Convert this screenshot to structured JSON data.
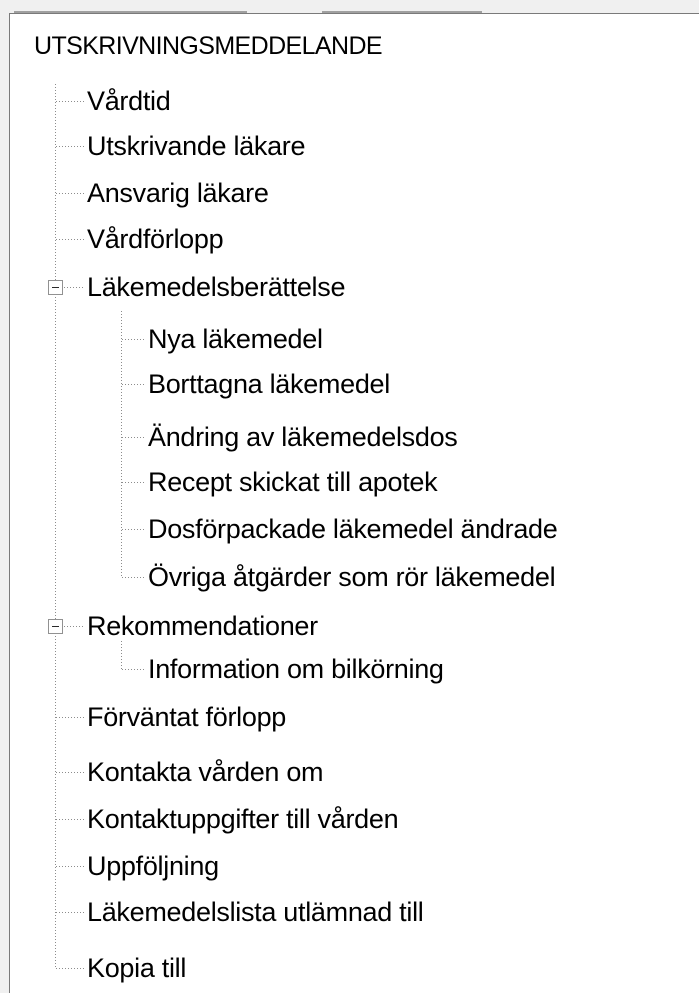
{
  "tree": {
    "root": "UTSKRIVNINGSMEDDELANDE",
    "items": [
      "Vårdtid",
      "Utskrivande läkare",
      "Ansvarig läkare",
      "Vårdförlopp",
      "Läkemedelsberättelse",
      "Nya läkemedel",
      "Borttagna läkemedel",
      "Ändring av läkemedelsdos",
      "Recept skickat till apotek",
      "Dosförpackade läkemedel ändrade",
      "Övriga åtgärder som rör läkemedel",
      "Rekommendationer",
      "Information om bilkörning",
      "Förväntat förlopp",
      "Kontakta vården om",
      "Kontaktuppgifter till vården",
      "Uppföljning",
      "Läkemedelslista utlämnad till",
      "Kopia till"
    ],
    "expanded": [
      "Läkemedelsberättelse",
      "Rekommendationer"
    ]
  },
  "colors": {
    "tree_line": "#8c8c8c",
    "panel_border": "#7a7a7a",
    "chrome": "#f0f0f0"
  },
  "icons": {
    "expanded_node": "collapse-minus-icon"
  }
}
